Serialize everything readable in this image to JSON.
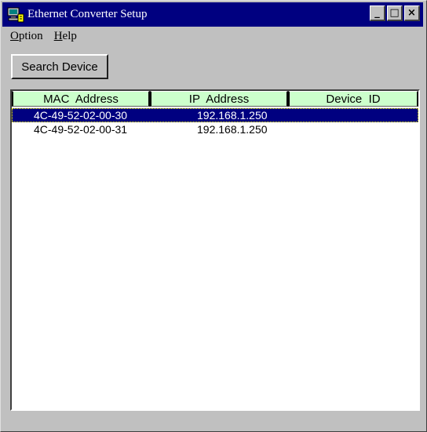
{
  "window": {
    "title": "Ethernet Converter Setup",
    "controls": {
      "minimize": "_",
      "maximize": "□",
      "close": "×"
    }
  },
  "menu": [
    {
      "label": "Option",
      "accel": "O",
      "rest": "ption"
    },
    {
      "label": "Help",
      "accel": "H",
      "rest": "elp"
    }
  ],
  "toolbar": {
    "search_label": "Search Device"
  },
  "table": {
    "headers": {
      "mac": "MAC  Address",
      "ip": "IP  Address",
      "device": "Device  ID"
    },
    "rows": [
      {
        "mac": "4C-49-52-02-00-30",
        "ip": "192.168.1.250",
        "device": "",
        "selected": true
      },
      {
        "mac": "4C-49-52-02-00-31",
        "ip": "192.168.1.250",
        "device": "",
        "selected": false
      }
    ]
  },
  "colors": {
    "titlebar": "#000080",
    "header_bg": "#ccffcc",
    "selection": "#000080",
    "face": "#c0c0c0"
  },
  "icons": [
    "computer-network-icon",
    "minimize-icon",
    "maximize-icon",
    "close-icon"
  ]
}
